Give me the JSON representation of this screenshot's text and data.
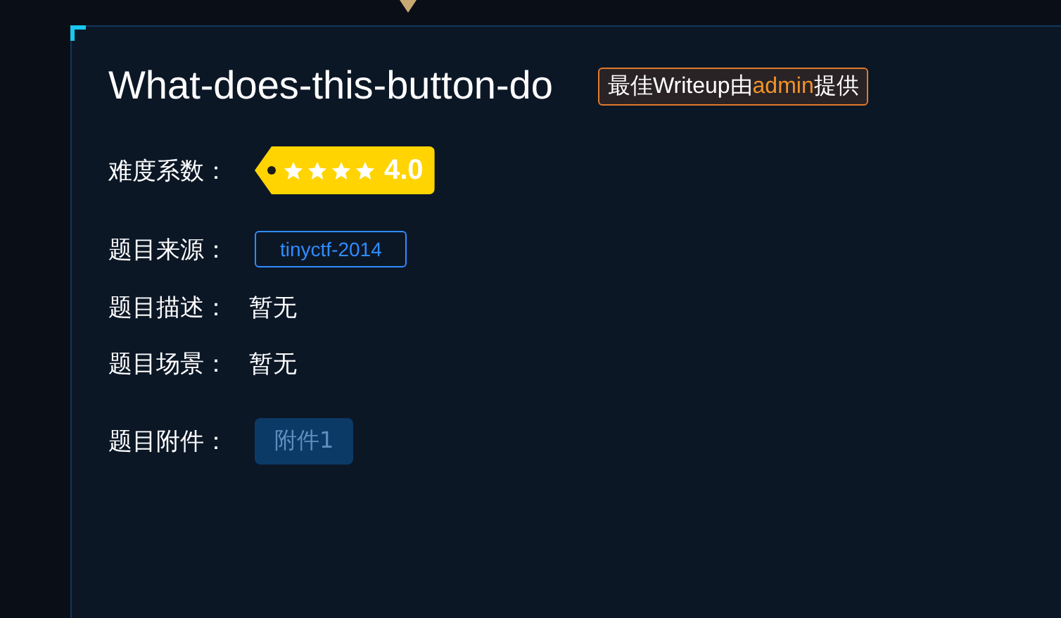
{
  "title": "What-does-this-button-do",
  "writeup_badge": {
    "prefix": "最佳Writeup由",
    "author": "admin",
    "suffix": "提供"
  },
  "fields": [
    {
      "kind": "rating",
      "label": "难度系数：",
      "stars": 4,
      "value": "4.0"
    },
    {
      "kind": "tag",
      "label": "题目来源：",
      "value": "tinyctf-2014"
    },
    {
      "kind": "text",
      "label": "题目描述：",
      "value": "暂无"
    },
    {
      "kind": "text",
      "label": "题目场景：",
      "value": "暂无"
    },
    {
      "kind": "attachment",
      "label": "题目附件：",
      "value": "附件1"
    }
  ]
}
